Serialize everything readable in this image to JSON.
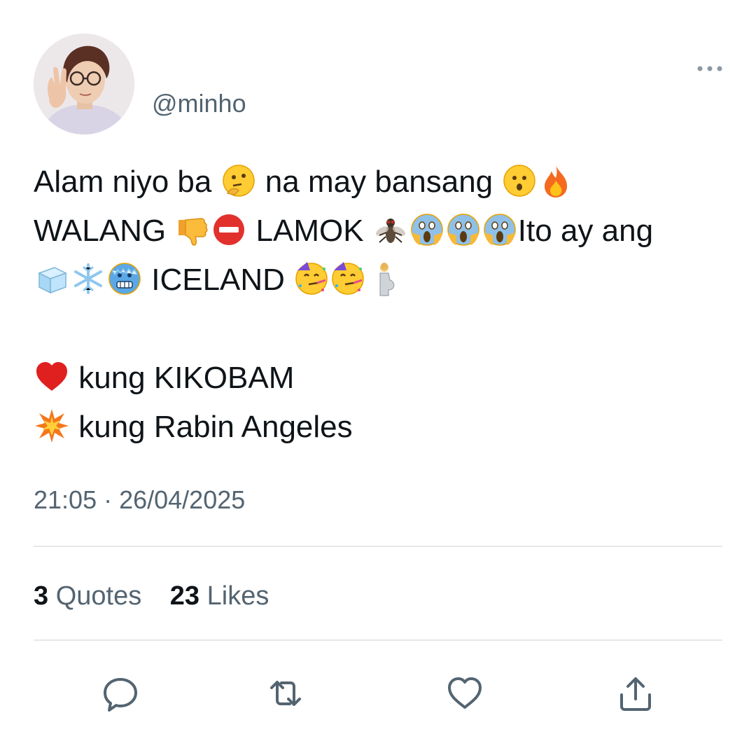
{
  "tweet": {
    "handle": "@minho",
    "lines": [
      [
        {
          "t": "Alam niyo ba "
        },
        {
          "e": "thinking-face-emoji"
        },
        {
          "t": " na may bansang "
        },
        {
          "e": "hushed-face-emoji"
        },
        {
          "e": "fire-emoji"
        }
      ],
      [
        {
          "t": "WALANG "
        },
        {
          "e": "thumbs-down-emoji"
        },
        {
          "e": "no-entry-emoji"
        },
        {
          "t": " LAMOK "
        },
        {
          "e": "fly-emoji"
        },
        {
          "e": "scream-face-emoji"
        },
        {
          "e": "scream-face-emoji"
        },
        {
          "e": "scream-face-emoji"
        },
        {
          "t": "Ito ay ang"
        }
      ],
      [
        {
          "e": "ice-cube-emoji"
        },
        {
          "e": "snowflake-emoji"
        },
        {
          "e": "cold-face-emoji"
        },
        {
          "t": " ICELAND "
        },
        {
          "e": "partying-face-emoji"
        },
        {
          "e": "partying-face-emoji"
        },
        {
          "e": "pregnant-man-emoji"
        }
      ],
      [],
      [
        {
          "e": "red-heart-emoji"
        },
        {
          "t": " kung KIKOBAM"
        }
      ],
      [
        {
          "e": "collision-emoji"
        },
        {
          "t": " kung Rabin Angeles"
        }
      ]
    ],
    "timestamp": "21:05 · 26/04/2025",
    "stats": {
      "quotes_count": "3",
      "quotes_label": "Quotes",
      "likes_count": "23",
      "likes_label": "Likes"
    },
    "actions": [
      "reply-icon",
      "retweet-icon",
      "like-icon",
      "share-icon"
    ],
    "more_icon": "more-options-icon"
  },
  "colors": {
    "text": "#0f1419",
    "secondary": "#536471",
    "divider": "#e5e8eb",
    "background": "#ffffff"
  }
}
